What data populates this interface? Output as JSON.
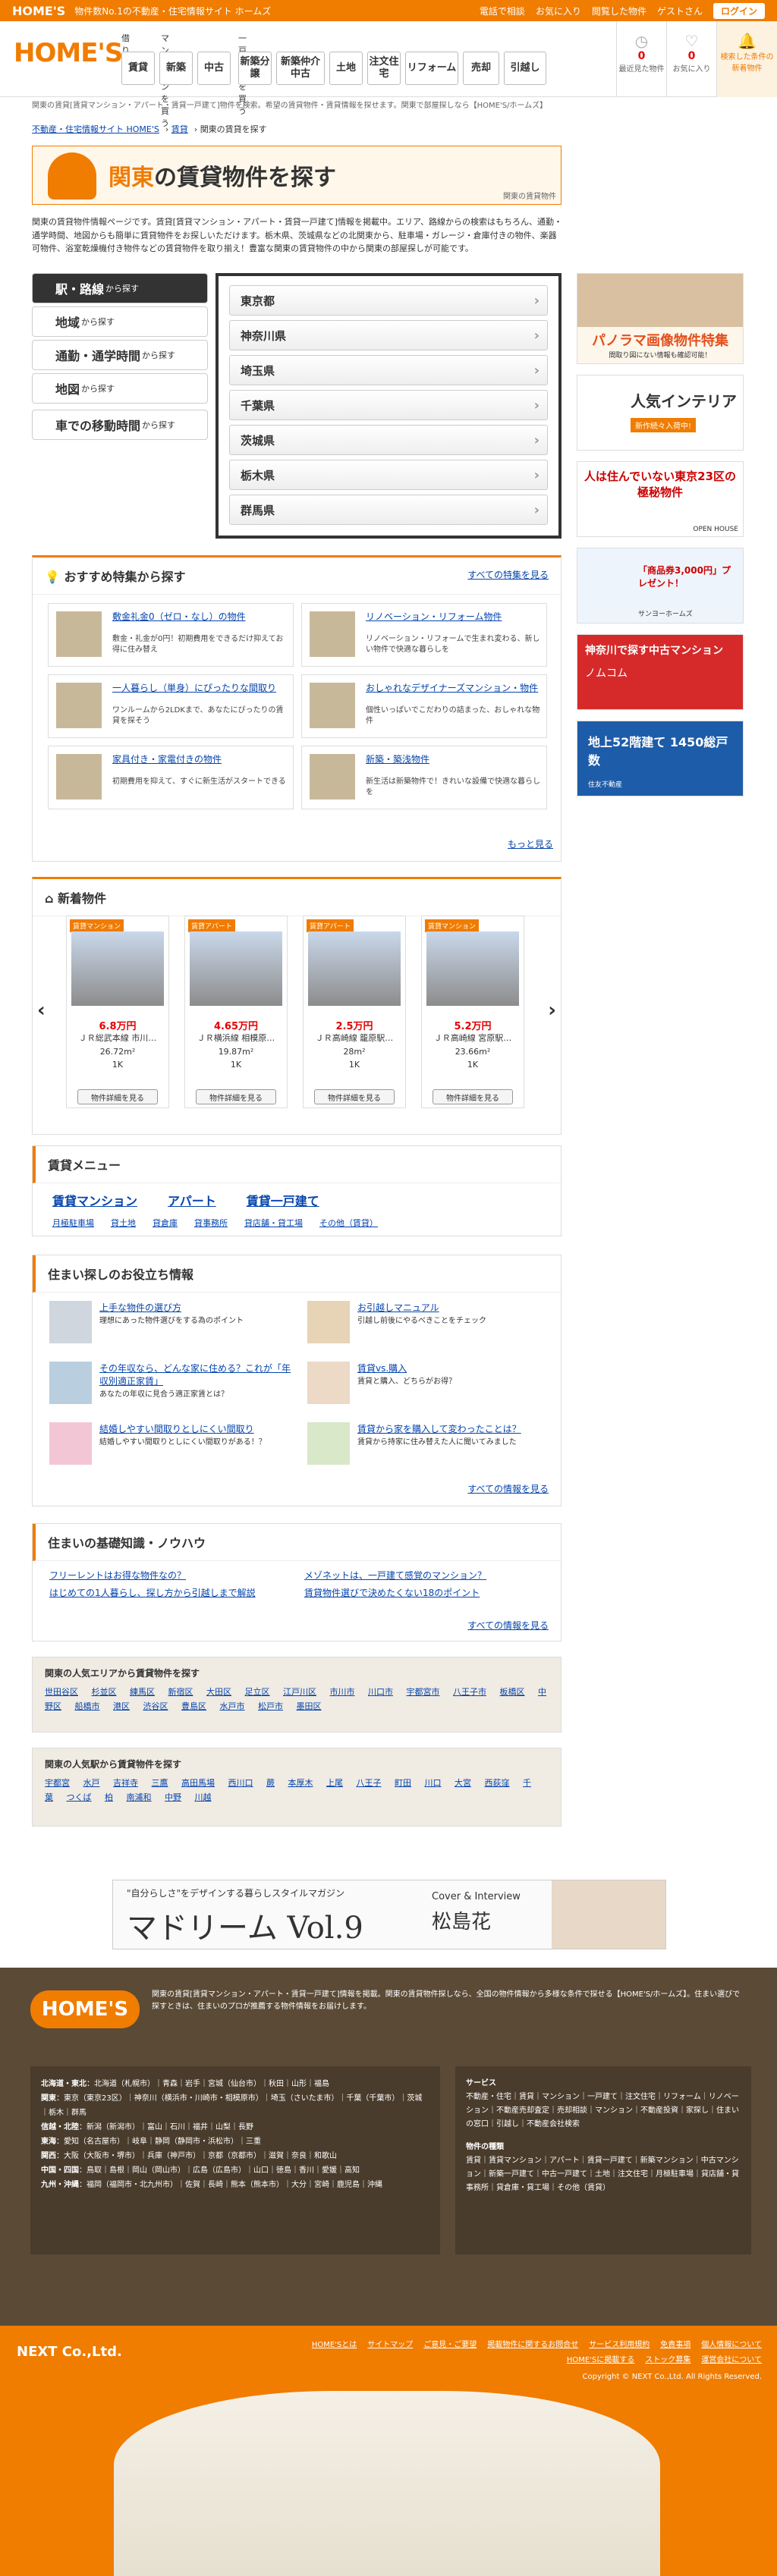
{
  "topbar": {
    "brand": "HOME'S",
    "tagline": "物件数No.1の不動産・住宅情報サイト ホームズ",
    "links": [
      "電話で相談",
      "お気に入り",
      "閲覧した物件"
    ],
    "user": "ゲストさん",
    "login": "ログイン"
  },
  "header": {
    "logo": "HOME'S",
    "groups": [
      "借りる",
      "マンションを買う",
      "一戸建てを買う"
    ],
    "nav": [
      "賃貸",
      "新築",
      "中古",
      "新築分譲",
      "新築仲介中古",
      "土地",
      "注文住宅",
      "リフォーム",
      "売却",
      "引越し"
    ],
    "icons": [
      {
        "label": "最近見た物件",
        "count": "0",
        "icon": "clock-icon"
      },
      {
        "label": "お気に入り",
        "count": "0",
        "icon": "heart-icon"
      },
      {
        "label": "検索した条件の新着物件",
        "count": "",
        "icon": "bell-icon"
      }
    ]
  },
  "breadcrumb": [
    "不動産・住宅情報サイト HOME'S",
    "賃貸",
    "関東の賃貸を探す"
  ],
  "subtitle_bar": "関東の賃貸[賃貸マンション・アパート・賃貸一戸建て]物件を検索。希望の賃貸物件・賃貸情報を探せます。関東で部屋探しなら【HOME'S/ホームズ】",
  "title": {
    "prefix": "関東",
    "rest": "の賃貸物件を探す",
    "sub": "関東の賃貸物件"
  },
  "intro": "関東の賃貸物件情報ページです。賃貸[賃貸マンション・アパート・賃貸一戸建て]情報を掲載中。エリア、路線からの検索はもちろん、通勤・通学時間、地図からも簡単に賃貸物件をお探しいただけます。栃木県、茨城県などの北関東から、駐車場・ガレージ・倉庫付きの物件、楽器可物件、浴室乾燥機付き物件などの賃貸物件を取り揃え！豊富な関東の賃貸物件の中から関東の部屋探しが可能です。",
  "search": {
    "tabs": [
      {
        "main": "駅・路線",
        "small": "から探す"
      },
      {
        "main": "地域",
        "small": "から探す"
      },
      {
        "main": "通勤・通学時間",
        "small": "から探す"
      },
      {
        "main": "地図",
        "small": "から探す"
      },
      {
        "main": "車での移動時間",
        "small": "から探す"
      }
    ],
    "prefs": [
      "東京都",
      "神奈川県",
      "埼玉県",
      "千葉県",
      "茨城県",
      "栃木県",
      "群馬県"
    ]
  },
  "featured": {
    "title": "おすすめ特集から探す",
    "all": "すべての特集を見る",
    "more": "もっと見る",
    "items": [
      {
        "title": "敷金礼金0（ゼロ・なし）の物件",
        "desc": "敷金・礼金が0円！初期費用をできるだけ抑えてお得に住み替え"
      },
      {
        "title": "リノベーション・リフォーム物件",
        "desc": "リノベーション・リフォームで生まれ変わる、新しい物件で快適な暮らしを"
      },
      {
        "title": "一人暮らし（単身）にぴったりな間取り",
        "desc": "ワンルームから2LDKまで、あなたにぴったりの賃貸を探そう"
      },
      {
        "title": "おしゃれなデザイナーズマンション・物件",
        "desc": "個性いっぱいでこだわりの詰まった、おしゃれな物件"
      },
      {
        "title": "家具付き・家電付きの物件",
        "desc": "初期費用を抑えて、すぐに新生活がスタートできる"
      },
      {
        "title": "新築・築浅物件",
        "desc": "新生活は新築物件で！きれいな設備で快適な暮らしを"
      }
    ]
  },
  "newlist": {
    "title": "新着物件",
    "items": [
      {
        "tag": "賃貸マンション",
        "price": "6.8万円",
        "line1": "ＪＲ総武本線 市川…",
        "size": "26.72m²",
        "layout": "1K",
        "btn": "物件詳細を見る"
      },
      {
        "tag": "賃貸アパート",
        "price": "4.65万円",
        "line1": "ＪＲ横浜線 相模原…",
        "size": "19.87m²",
        "layout": "1K",
        "btn": "物件詳細を見る"
      },
      {
        "tag": "賃貸アパート",
        "price": "2.5万円",
        "line1": "ＪＲ高崎線 籠原駅…",
        "size": "28m²",
        "layout": "1K",
        "btn": "物件詳細を見る"
      },
      {
        "tag": "賃貸マンション",
        "price": "5.2万円",
        "line1": "ＪＲ高崎線 宮原駅…",
        "size": "23.66m²",
        "layout": "1K",
        "btn": "物件詳細を見る"
      }
    ]
  },
  "menu": {
    "title": "賃貸メニュー",
    "main": [
      "賃貸マンション",
      "アパート",
      "賃貸一戸建て"
    ],
    "sub": [
      "月極駐車場",
      "貸土地",
      "貸倉庫",
      "貸事務所",
      "貸店舗・貸工場",
      "その他（賃貸）"
    ]
  },
  "tips": {
    "title": "住まい探しのお役立ち情報",
    "all": "すべての情報を見る",
    "items": [
      {
        "title": "上手な物件の選び方",
        "desc": "理想にあった物件選びをする為のポイント"
      },
      {
        "title": "お引越しマニュアル",
        "desc": "引越し前後にやるべきことをチェック"
      },
      {
        "title": "その年収なら、どんな家に住める？これが「年収別適正家賃」",
        "desc": "あなたの年収に見合う適正家賃とは？"
      },
      {
        "title": "賃貸vs.購入",
        "desc": "賃貸と購入、どちらがお得？"
      },
      {
        "title": "結婚しやすい間取りとしにくい間取り",
        "desc": "結婚しやすい間取りとしにくい間取りがある！？"
      },
      {
        "title": "賃貸から家を購入して変わったことは？",
        "desc": "賃貸から持家に住み替えた人に聞いてみました"
      }
    ]
  },
  "knowhow": {
    "title": "住まいの基礎知識・ノウハウ",
    "items": [
      "フリーレントはお得な物件なの？",
      "メゾネットは、一戸建て感覚のマンション？",
      "はじめての1人暮らし、探し方から引越しまで解説",
      "賃貸物件選びで決めたくない18のポイント"
    ],
    "all": "すべての情報を見る"
  },
  "popular_area": {
    "title": "関東の人気エリアから賃貸物件を探す",
    "items": [
      "世田谷区",
      "杉並区",
      "練馬区",
      "新宿区",
      "大田区",
      "足立区",
      "江戸川区",
      "市川市",
      "川口市",
      "宇都宮市",
      "八王子市",
      "板橋区",
      "中野区",
      "船橋市",
      "港区",
      "渋谷区",
      "豊島区",
      "水戸市",
      "松戸市",
      "墨田区"
    ]
  },
  "popular_station": {
    "title": "関東の人気駅から賃貸物件を探す",
    "items": [
      "宇都宮",
      "水戸",
      "吉祥寺",
      "三鷹",
      "高田馬場",
      "西川口",
      "蕨",
      "本厚木",
      "上尾",
      "八王子",
      "町田",
      "川口",
      "大宮",
      "西荻窪",
      "千葉",
      "つくば",
      "柏",
      "南浦和",
      "中野",
      "川越"
    ]
  },
  "banner": {
    "text": "\"自分らしさ\"をデザインする暮らしスタイルマガジン",
    "title": "マドリーム Vol.9",
    "sub": "Cover & Interview",
    "name": "松島花"
  },
  "sidebar": [
    {
      "title": "パノラマ画像物件特集",
      "sub": "間取り図にない情報も確認可能！"
    },
    {
      "title": "人気インテリア",
      "sub": "新作続々入荷中!"
    },
    {
      "title": "人は住んでいない東京23区の極秘物件",
      "sub": "OPEN HOUSE"
    },
    {
      "title": "「商品券3,000円」プレゼント！",
      "sub": "サンヨーホームズ"
    },
    {
      "title": "神奈川で探す中古マンション",
      "sub": "ノムコム"
    },
    {
      "title": "地上52階建て 1450総戸数",
      "sub": "住友不動産"
    }
  ],
  "footer": {
    "logo": "HOME'S",
    "desc": "関東の賃貸[賃貸マンション・アパート・賃貸一戸建て]情報を掲載。関東の賃貸物件探しなら、全国の物件情報から多様な条件で探せる【HOME'S/ホームズ】。住まい選びで探すときは、住まいのプロが推薦する物件情報をお届けします。",
    "regions": [
      {
        "name": "北海道・東北",
        "items": "北海道（札幌市）｜青森｜岩手｜宮城（仙台市）｜秋田｜山形｜福島"
      },
      {
        "name": "関東",
        "items": "東京（東京23区）｜神奈川（横浜市・川崎市・相模原市）｜埼玉（さいたま市）｜千葉（千葉市）｜茨城｜栃木｜群馬"
      },
      {
        "name": "信越・北陸",
        "items": "新潟（新潟市）｜富山｜石川｜福井｜山梨｜長野"
      },
      {
        "name": "東海",
        "items": "愛知（名古屋市）｜岐阜｜静岡（静岡市・浜松市）｜三重"
      },
      {
        "name": "関西",
        "items": "大阪（大阪市・堺市）｜兵庫（神戸市）｜京都（京都市）｜滋賀｜奈良｜和歌山"
      },
      {
        "name": "中国・四国",
        "items": "鳥取｜島根｜岡山（岡山市）｜広島（広島市）｜山口｜徳島｜香川｜愛媛｜高知"
      },
      {
        "name": "九州・沖縄",
        "items": "福岡（福岡市・北九州市）｜佐賀｜長崎｜熊本（熊本市）｜大分｜宮崎｜鹿児島｜沖縄"
      }
    ],
    "services": {
      "title": "サービス",
      "items": "不動産・住宅｜賃貸｜マンション｜一戸建て｜注文住宅｜リフォーム｜リノベーション｜不動産売却査定｜売却相談｜マンション｜不動産投資｜家探し｜住まいの窓口｜引越し｜不動産会社検索"
    },
    "types": {
      "title": "物件の種類",
      "items": "賃貸｜賃貸マンション｜アパート｜賃貸一戸建て｜新築マンション｜中古マンション｜新築一戸建て｜中古一戸建て｜土地｜注文住宅｜月極駐車場｜貸店舗・貸事務所｜貸倉庫・貸工場｜その他（賃貸）"
    }
  },
  "corp": {
    "name": "NEXT Co.,Ltd.",
    "links": [
      "HOME'Sとは",
      "サイトマップ",
      "ご意見・ご要望",
      "掲載物件に関するお問合せ",
      "サービス利用規約",
      "免責事項",
      "個人情報について",
      "HOME'Sに掲載する",
      "ストック募集",
      "運営会社について"
    ],
    "copyright": "Copyright © NEXT Co.,Ltd. All Rights Reserved."
  }
}
